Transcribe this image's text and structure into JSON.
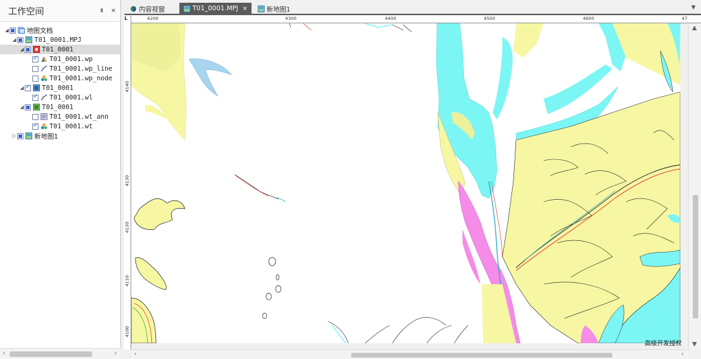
{
  "workspace": {
    "title": "工作空间",
    "pin": "⇟",
    "close": "×",
    "tree": [
      {
        "label": "地图文档",
        "level": 0,
        "twisty": "◢",
        "check": "partial",
        "icon": "map-document-icon"
      },
      {
        "label": "T01_0001.MPJ",
        "level": 1,
        "twisty": "◢",
        "check": "partial",
        "icon": "map-project-icon"
      },
      {
        "label": "T01_0001",
        "level": 2,
        "twisty": "◢",
        "check": "partial",
        "icon": "point-layer-group-icon",
        "selected": true
      },
      {
        "label": "T01_0001.wp",
        "level": 3,
        "twisty": "",
        "check": "checked",
        "icon": "polygon-layer-icon"
      },
      {
        "label": "T01_0001.wp_line",
        "level": 3,
        "twisty": "",
        "check": "unchecked",
        "icon": "line-layer-icon"
      },
      {
        "label": "T01_0001.wp_node",
        "level": 3,
        "twisty": "",
        "check": "unchecked",
        "icon": "node-layer-icon"
      },
      {
        "label": "T01_0001",
        "level": 2,
        "twisty": "◢",
        "check": "checked",
        "icon": "line-layer-group-icon"
      },
      {
        "label": "T01_0001.wl",
        "level": 3,
        "twisty": "",
        "check": "checked",
        "icon": "line-layer-icon"
      },
      {
        "label": "T01_0001",
        "level": 2,
        "twisty": "◢",
        "check": "partial",
        "icon": "annotation-layer-group-icon"
      },
      {
        "label": "T01_0001.wt_ann",
        "level": 3,
        "twisty": "",
        "check": "unchecked",
        "icon": "annotation-layer-icon"
      },
      {
        "label": "T01_0001.wt",
        "level": 3,
        "twisty": "",
        "check": "checked",
        "icon": "node-layer-icon"
      },
      {
        "label": "新地图1",
        "level": 1,
        "twisty": "▷",
        "check": "partial",
        "icon": "map-project-icon"
      }
    ],
    "scroll_left": "‹",
    "scroll_right": "›"
  },
  "tabs": [
    {
      "label": "内容视窗",
      "icon": "content-view-icon",
      "active": false
    },
    {
      "label": "T01_0001.MPJ",
      "icon": "map-project-icon",
      "active": true,
      "close": "×"
    },
    {
      "label": "新地图1",
      "icon": "map-project-icon",
      "active": false
    }
  ],
  "tab_menu": "▼",
  "ruler": {
    "corner": "L",
    "top_labels": [
      "4200",
      "4300",
      "4400",
      "4500",
      "4600",
      "47"
    ],
    "left_labels": [
      "4140",
      "4130",
      "4120",
      "4110",
      "4100"
    ]
  },
  "map_scroll": {
    "left": "‹",
    "right": "›",
    "up": "▲",
    "down": "▼"
  },
  "watermark": "高级开发授权",
  "colors": {
    "yellow": "#f7f7a3",
    "cyan": "#7cf5f5",
    "pink": "#f48ce8",
    "lightblue": "#a8d4f0",
    "olive": "#eef09a",
    "tab_active": "#5a5a5a"
  }
}
